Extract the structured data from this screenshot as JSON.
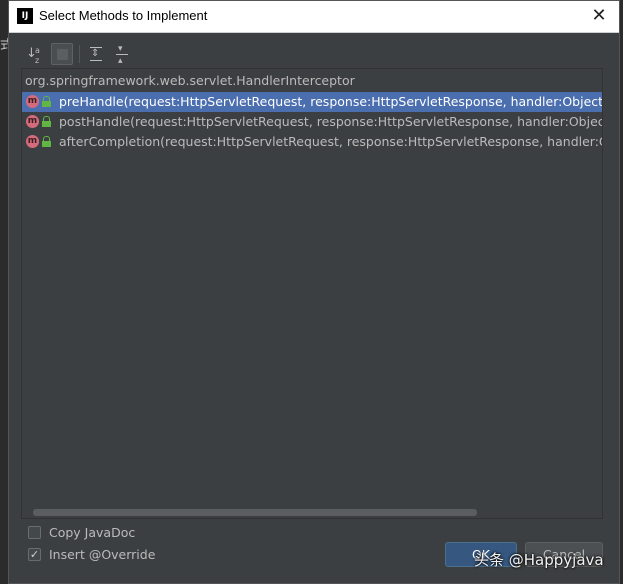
{
  "side_glyph": "式",
  "window": {
    "app_icon": "IJ",
    "title": "Select Methods to Implement",
    "close_glyph": "✕"
  },
  "toolbar": {
    "sort_icon": "sort-alphabetically-icon",
    "toggle_icon": "show-classes-toggle-icon",
    "expand_icon": "expand-all-icon",
    "collapse_icon": "collapse-all-icon"
  },
  "tree": {
    "header": "org.springframework.web.servlet.HandlerInterceptor",
    "items": [
      {
        "icon": "m",
        "text": "preHandle(request:HttpServletRequest, response:HttpServletResponse, handler:Object):boolean",
        "selected": true
      },
      {
        "icon": "m",
        "text": "postHandle(request:HttpServletRequest, response:HttpServletResponse, handler:Object, modelAndView:ModelAndView):void",
        "selected": false
      },
      {
        "icon": "m",
        "text": "afterCompletion(request:HttpServletRequest, response:HttpServletResponse, handler:Object, ex:Exception):void",
        "selected": false
      }
    ]
  },
  "options": {
    "copy_javadoc": {
      "label": "Copy JavaDoc",
      "checked": false
    },
    "insert_override": {
      "label": "Insert @Override",
      "checked": true
    }
  },
  "buttons": {
    "ok": "OK",
    "cancel": "Cancel"
  },
  "watermark": "头条 @Happyjava",
  "colors": {
    "background": "#3c3f41",
    "selection": "#4b6eaf",
    "method_icon": "#d36b7c",
    "lock_icon": "#62b543",
    "ok_button": "#365880"
  }
}
